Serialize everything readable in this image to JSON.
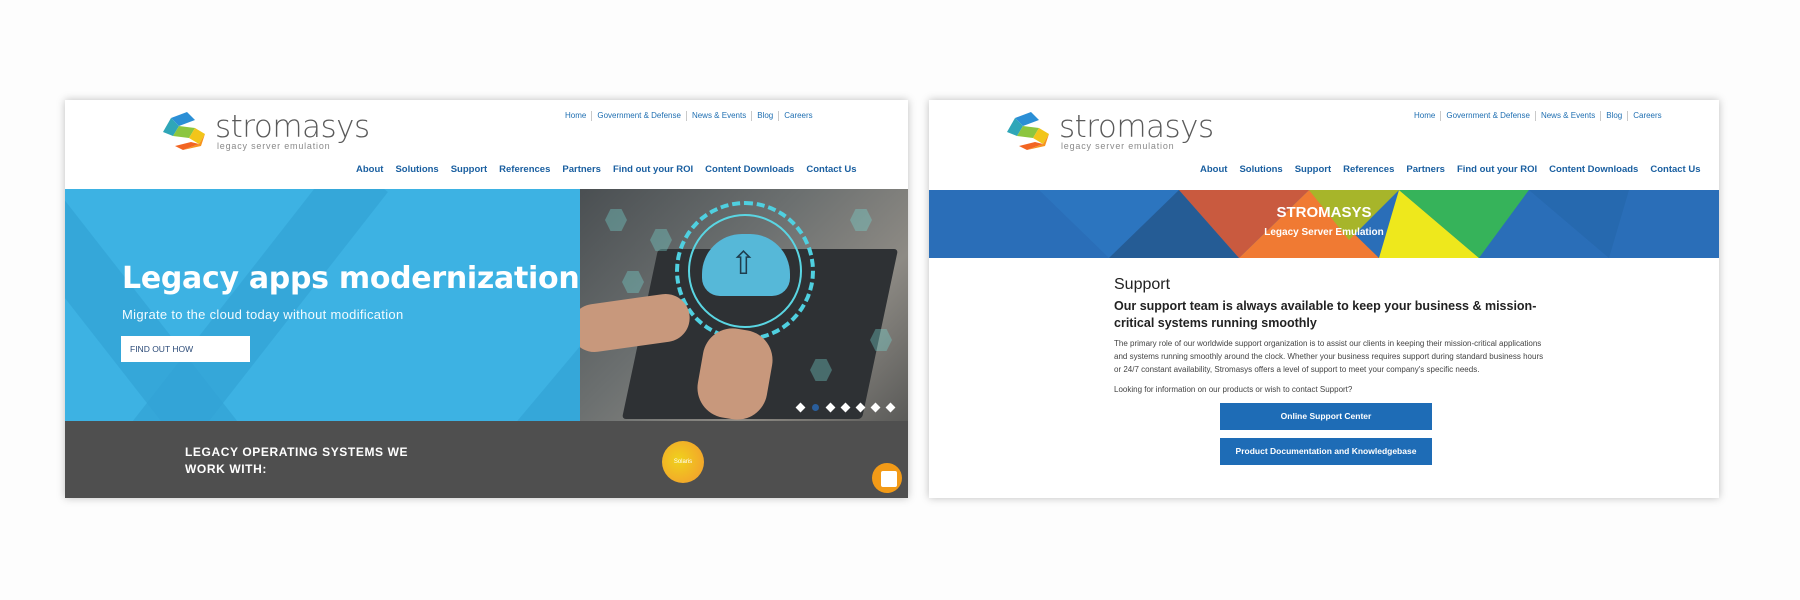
{
  "brand": {
    "name": "stromasys",
    "tagline": "legacy server emulation"
  },
  "top_nav": [
    "Home",
    "Government & Defense",
    "News & Events",
    "Blog",
    "Careers"
  ],
  "main_nav": [
    "About",
    "Solutions",
    "Support",
    "References",
    "Partners",
    "Find out your ROI",
    "Content Downloads",
    "Contact Us"
  ],
  "home_page": {
    "hero": {
      "title": "Legacy apps modernization:",
      "subtitle": "Migrate to the cloud today without modification",
      "cta_label": "FIND OUT HOW",
      "slide_count": 7,
      "active_slide": 2
    },
    "os_section": {
      "title_line1": "LEGACY OPERATING SYSTEMS WE",
      "title_line2": "WORK WITH:",
      "badge_label": "Solaris"
    },
    "chat_icon": "chat-icon"
  },
  "support_page": {
    "banner": {
      "title": "STROMASYS",
      "subtitle": "Legacy Server Emulation"
    },
    "title": "Support",
    "heading": "Our support team is always available to keep your business & mission-critical systems running smoothly",
    "body": "The primary role of our worldwide support organization is to assist our clients in keeping their mission-critical applications and systems running smoothly around the clock. Whether your business requires support during standard business hours or 24/7 constant availability, Stromasys offers a level of support to meet your company's specific needs.",
    "question": "Looking for information on our products or wish to contact Support?",
    "buttons": [
      "Online Support Center",
      "Product Documentation and Knowledgebase"
    ]
  },
  "colors": {
    "brand_blue": "#1e6cb6",
    "hero_blue": "#3db2e3",
    "dark_band": "#4f4f4f",
    "chat_orange": "#f29a17",
    "nav_blue": "#1a5fa0"
  }
}
